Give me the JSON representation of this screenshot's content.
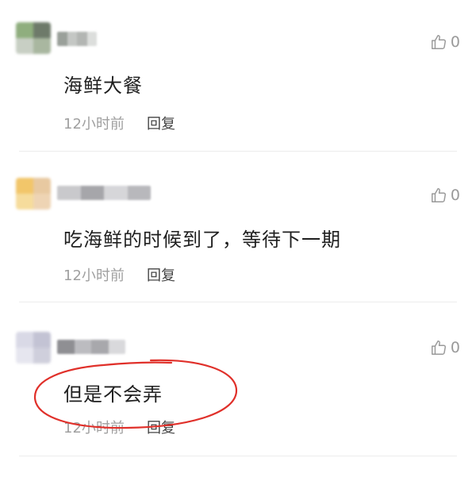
{
  "comments": [
    {
      "content": "海鲜大餐",
      "time": "12小时前",
      "reply": "回复",
      "likes": "0",
      "avatar_colors": [
        "#8fae7e",
        "#6e7a6a",
        "#c8cfc4",
        "#a9b7a0"
      ],
      "username_colors": [
        "#9aa09a",
        "#c4c7c4",
        "#b3b6b3",
        "#dcdedc"
      ]
    },
    {
      "content": "吃海鲜的时候到了，等待下一期",
      "time": "12小时前",
      "reply": "回复",
      "likes": "0",
      "avatar_colors": [
        "#f2c66a",
        "#e8c9a1",
        "#f6dc9c",
        "#eed4b4"
      ],
      "username_colors": [
        "#c9c9cc",
        "#a6a6aa",
        "#d6d6d9",
        "#b8b8bc"
      ]
    },
    {
      "content": "但是不会弄",
      "time": "12小时前",
      "reply": "回复",
      "likes": "0",
      "avatar_colors": [
        "#d9d9e6",
        "#c3c3d4",
        "#e6e6ef",
        "#cfcfdc"
      ],
      "username_colors": [
        "#8f8f93",
        "#bcbcc0",
        "#a8a8ac",
        "#d9d9dc"
      ]
    }
  ],
  "annotation_color": "#e0302a",
  "icons": {
    "like": "thumbs-up-icon"
  }
}
